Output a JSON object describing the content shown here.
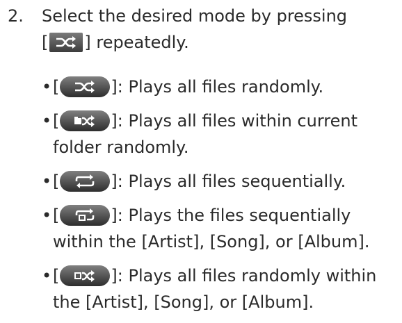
{
  "step": {
    "number": "2.",
    "text_before": "Select the desired mode by pressing",
    "bracket_open": "[",
    "bracket_close": "]",
    "text_after": "repeatedly.",
    "button_icon": "shuffle-icon"
  },
  "modes": [
    {
      "icon": "shuffle-icon",
      "text": ": Plays all files randomly."
    },
    {
      "icon": "folder-shuffle-icon",
      "text": ": Plays all files within current folder randomly."
    },
    {
      "icon": "repeat-icon",
      "text": ": Plays all files sequentially."
    },
    {
      "icon": "group-repeat-icon",
      "text": ": Plays the files sequentially within the [Artist], [Song], or [Album]."
    },
    {
      "icon": "group-shuffle-icon",
      "text": ": Plays all files randomly within the [Artist], [Song], or [Album]."
    }
  ],
  "bullet": "•",
  "bracket_open": "[",
  "bracket_close": "]",
  "colors": {
    "text": "#2a2a2a",
    "button_top": "#808080",
    "button_bottom": "#2d2d2d",
    "icon": "#ffffff"
  }
}
